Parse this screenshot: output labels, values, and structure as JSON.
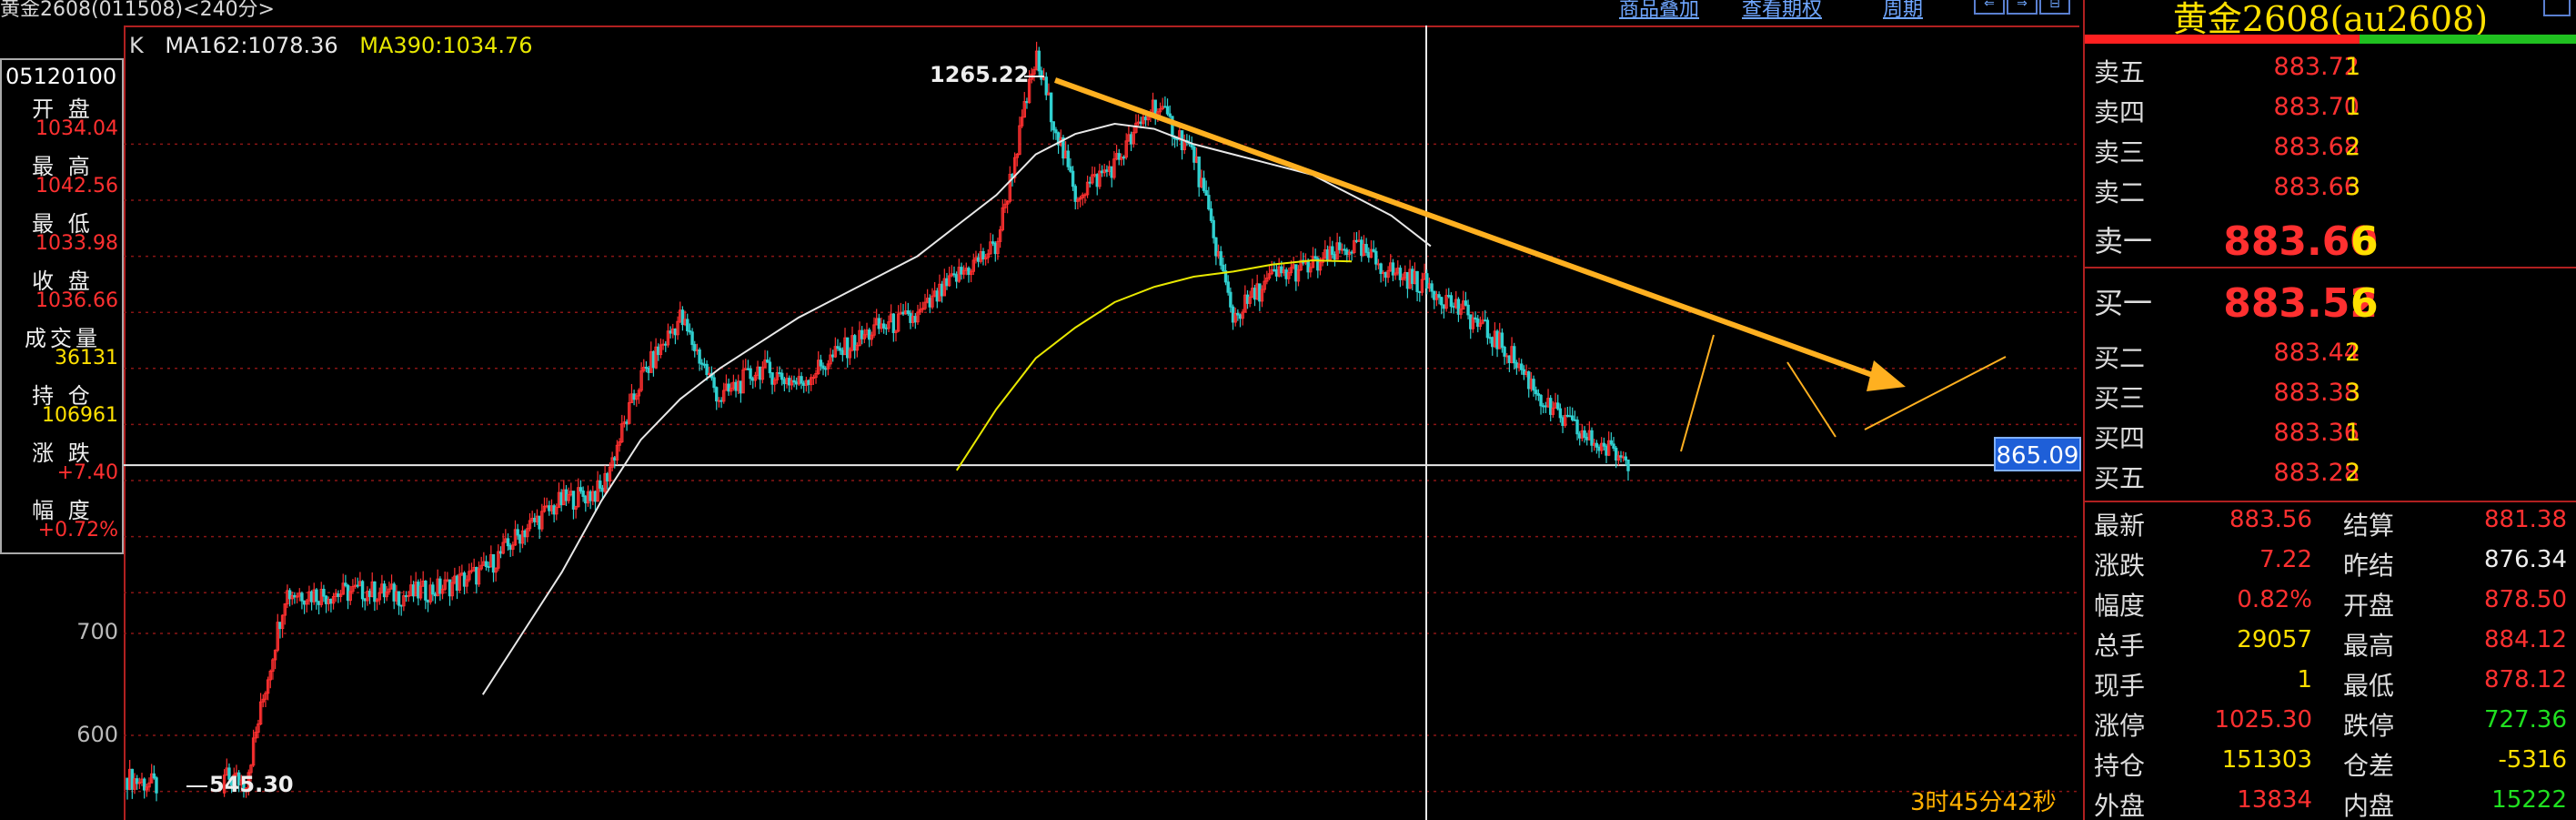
{
  "window_title": "黄金2608(011508)<240分>",
  "toolbar": {
    "overlay_label": "商品叠加",
    "options_label": "查看期权",
    "period_label": "周期",
    "nav_buttons": [
      "⇐",
      "⇒",
      "⊟"
    ]
  },
  "ma_legend": {
    "k": "K",
    "ma162": "MA162:1078.36",
    "ma390": "MA390:1034.76"
  },
  "info_box": {
    "date": "05120100",
    "rows": [
      {
        "label": "开 盘",
        "value": "1034.04",
        "color": "#ff3030"
      },
      {
        "label": "最 高",
        "value": "1042.56",
        "color": "#ff3030"
      },
      {
        "label": "最 低",
        "value": "1033.98",
        "color": "#ff3030"
      },
      {
        "label": "收 盘",
        "value": "1036.66",
        "color": "#ff3030"
      },
      {
        "label": "成交量",
        "value": "36131",
        "color": "#ffe000"
      },
      {
        "label": "持 仓",
        "value": "106961",
        "color": "#ffe000"
      },
      {
        "label": "涨 跌",
        "value": "+7.40",
        "color": "#ff3030"
      },
      {
        "label": "幅 度",
        "value": "+0.72%",
        "color": "#ff3030"
      }
    ]
  },
  "y_axis_labels": [
    "700",
    "600"
  ],
  "annotations": {
    "high": "1265.22",
    "low": "545.30",
    "crosshair_price": "865.09",
    "countdown": "3时45分42秒"
  },
  "chart_data": {
    "type": "line",
    "title": "",
    "symbol": "黄金2608",
    "period": "240分",
    "y_ticks": [
      700,
      600
    ],
    "ylim": [
      520,
      1290
    ],
    "high_marker": 1265.22,
    "low_marker": 545.3,
    "crosshair_value": 865.09,
    "series": [
      {
        "name": "K",
        "color": "#ff3030",
        "values": [
          558,
          548,
          562,
          555,
          740,
          738,
          742,
          737,
          745,
          760,
          800,
          830,
          840,
          950,
          1010,
          930,
          960,
          945,
          975,
          1000,
          1010,
          1050,
          1080,
          1265,
          1130,
          1160,
          1220,
          1170,
          1010,
          1050,
          1060,
          1080,
          1055,
          1040,
          1010,
          975,
          920,
          890,
          870
        ]
      },
      {
        "name": "MA162:1078.36",
        "color": "#e8e8e8",
        "values": [
          null,
          null,
          null,
          null,
          null,
          null,
          null,
          null,
          null,
          640,
          700,
          760,
          830,
          890,
          930,
          960,
          985,
          1010,
          1030,
          1050,
          1070,
          1100,
          1130,
          1170,
          1190,
          1200,
          1195,
          1180,
          1170,
          1160,
          1150,
          1130,
          1110,
          1080,
          null,
          null,
          null,
          null,
          null
        ]
      },
      {
        "name": "MA390:1034.76",
        "color": "#e8e800",
        "values": [
          null,
          null,
          null,
          null,
          null,
          null,
          null,
          null,
          null,
          null,
          null,
          null,
          null,
          null,
          null,
          null,
          null,
          null,
          null,
          null,
          null,
          860,
          920,
          970,
          1000,
          1025,
          1040,
          1050,
          1055,
          1062,
          1066,
          1065,
          null,
          null,
          null,
          null,
          null,
          null,
          null
        ]
      }
    ]
  },
  "quote_panel": {
    "title": "黄金2608(au2608)",
    "asks": [
      {
        "label": "卖五",
        "price": "883.72",
        "volume": "1"
      },
      {
        "label": "卖四",
        "price": "883.70",
        "volume": "1"
      },
      {
        "label": "卖三",
        "price": "883.68",
        "volume": "2"
      },
      {
        "label": "卖二",
        "price": "883.66",
        "volume": "3"
      },
      {
        "label": "卖一",
        "price": "883.60",
        "volume": "6"
      }
    ],
    "bids": [
      {
        "label": "买一",
        "price": "883.52",
        "volume": "6"
      },
      {
        "label": "买二",
        "price": "883.44",
        "volume": "2"
      },
      {
        "label": "买三",
        "price": "883.38",
        "volume": "3"
      },
      {
        "label": "买四",
        "price": "883.36",
        "volume": "1"
      },
      {
        "label": "买五",
        "price": "883.28",
        "volume": "2"
      }
    ],
    "stats": [
      {
        "l1": "最新",
        "v1": "883.56",
        "c1": "c-red",
        "l2": "结算",
        "v2": "881.38",
        "c2": "c-red"
      },
      {
        "l1": "涨跌",
        "v1": "7.22",
        "c1": "c-red",
        "l2": "昨结",
        "v2": "876.34",
        "c2": "c-wht"
      },
      {
        "l1": "幅度",
        "v1": "0.82%",
        "c1": "c-red",
        "l2": "开盘",
        "v2": "878.50",
        "c2": "c-red"
      },
      {
        "l1": "总手",
        "v1": "29057",
        "c1": "c-yel",
        "l2": "最高",
        "v2": "884.12",
        "c2": "c-red"
      },
      {
        "l1": "现手",
        "v1": "1",
        "c1": "c-yel",
        "l2": "最低",
        "v2": "878.12",
        "c2": "c-red"
      },
      {
        "l1": "涨停",
        "v1": "1025.30",
        "c1": "c-red",
        "l2": "跌停",
        "v2": "727.36",
        "c2": "c-grn"
      },
      {
        "l1": "持仓",
        "v1": "151303",
        "c1": "c-yel",
        "l2": "仓差",
        "v2": "-5316",
        "c2": "c-yel"
      },
      {
        "l1": "外盘",
        "v1": "13834",
        "c1": "c-red",
        "l2": "内盘",
        "v2": "15222",
        "c2": "c-grn"
      }
    ]
  }
}
